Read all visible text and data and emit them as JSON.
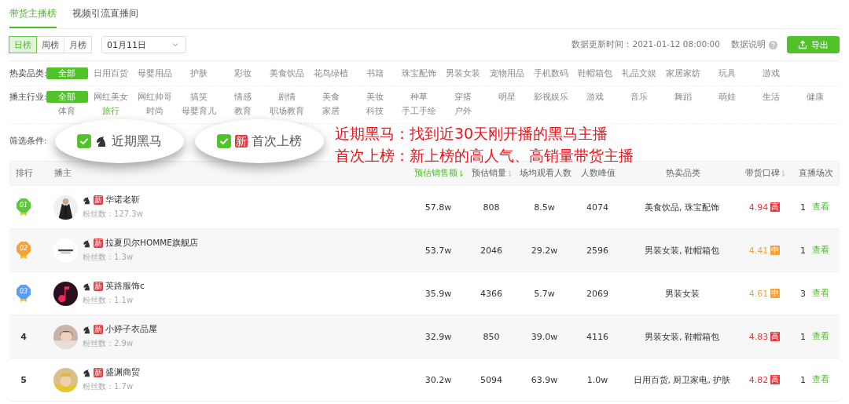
{
  "tabs": [
    {
      "label": "带货主播榜",
      "selected": true
    },
    {
      "label": "视频引流直播间",
      "selected": false
    }
  ],
  "periods": [
    {
      "label": "日榜",
      "selected": true
    },
    {
      "label": "周榜",
      "selected": false
    },
    {
      "label": "月榜",
      "selected": false
    }
  ],
  "date_select": {
    "value": "01月11日"
  },
  "update_time": "数据更新时间：2021-01-12 08:00:00",
  "data_help": "数据说明",
  "export_button": "导出",
  "hot_categories": {
    "label": "热卖品类:",
    "items": [
      {
        "label": "全部",
        "selected": true
      },
      {
        "label": "日用百货",
        "selected": false
      },
      {
        "label": "母婴用品",
        "selected": false
      },
      {
        "label": "护肤",
        "selected": false
      },
      {
        "label": "彩妆",
        "selected": false
      },
      {
        "label": "美食饮品",
        "selected": false
      },
      {
        "label": "花鸟绿植",
        "selected": false
      },
      {
        "label": "书籍",
        "selected": false
      },
      {
        "label": "珠宝配饰",
        "selected": false
      },
      {
        "label": "男装女装",
        "selected": false
      },
      {
        "label": "宠物用品",
        "selected": false
      },
      {
        "label": "手机数码",
        "selected": false
      },
      {
        "label": "鞋帽箱包",
        "selected": false
      },
      {
        "label": "礼品文娱",
        "selected": false
      },
      {
        "label": "家居家纺",
        "selected": false
      },
      {
        "label": "玩具",
        "selected": false
      },
      {
        "label": "游戏",
        "selected": false
      }
    ]
  },
  "industries": {
    "label": "播主行业:",
    "items": [
      {
        "label": "全部",
        "selected": true,
        "highlighted": false
      },
      {
        "label": "网红美女",
        "selected": false,
        "highlighted": false
      },
      {
        "label": "网红帅哥",
        "selected": false,
        "highlighted": false
      },
      {
        "label": "搞笑",
        "selected": false,
        "highlighted": false
      },
      {
        "label": "情感",
        "selected": false,
        "highlighted": false
      },
      {
        "label": "剧情",
        "selected": false,
        "highlighted": false
      },
      {
        "label": "美食",
        "selected": false,
        "highlighted": false
      },
      {
        "label": "美妆",
        "selected": false,
        "highlighted": false
      },
      {
        "label": "种草",
        "selected": false,
        "highlighted": false
      },
      {
        "label": "穿搭",
        "selected": false,
        "highlighted": false
      },
      {
        "label": "明星",
        "selected": false,
        "highlighted": false
      },
      {
        "label": "影视娱乐",
        "selected": false,
        "highlighted": false
      },
      {
        "label": "游戏",
        "selected": false,
        "highlighted": false
      },
      {
        "label": "音乐",
        "selected": false,
        "highlighted": false
      },
      {
        "label": "舞蹈",
        "selected": false,
        "highlighted": false
      },
      {
        "label": "萌娃",
        "selected": false,
        "highlighted": false
      },
      {
        "label": "生活",
        "selected": false,
        "highlighted": false
      },
      {
        "label": "健康",
        "selected": false,
        "highlighted": false
      },
      {
        "label": "体育",
        "selected": false,
        "highlighted": false
      },
      {
        "label": "旅行",
        "selected": false,
        "highlighted": true
      },
      {
        "label": "时尚",
        "selected": false,
        "highlighted": false
      },
      {
        "label": "母婴育儿",
        "selected": false,
        "highlighted": false
      },
      {
        "label": "教育",
        "selected": false,
        "highlighted": false
      },
      {
        "label": "职场教育",
        "selected": false,
        "highlighted": false
      },
      {
        "label": "家居",
        "selected": false,
        "highlighted": false
      },
      {
        "label": "科技",
        "selected": false,
        "highlighted": false
      },
      {
        "label": "手工手绘",
        "selected": false,
        "highlighted": false
      },
      {
        "label": "户外",
        "selected": false,
        "highlighted": false
      }
    ]
  },
  "filters": {
    "label": "筛选条件:",
    "options": [
      {
        "kind": "horse",
        "label": "近期黑马",
        "checked": true
      },
      {
        "kind": "badge",
        "badge": "新",
        "label": "首次上榜",
        "checked": true
      }
    ]
  },
  "annotation": [
    "近期黑马：找到近30天刚开播的黑马主播",
    "首次上榜：新上榜的高人气、高销量带货主播"
  ],
  "table": {
    "columns": [
      {
        "label": "排行"
      },
      {
        "label": "播主"
      },
      {
        "label": "预估销售额",
        "sorted": true
      },
      {
        "label": "预估销量",
        "sorted": false
      },
      {
        "label": "场均观看人数"
      },
      {
        "label": "人数峰值"
      },
      {
        "label": "热卖品类"
      },
      {
        "label": "带货口碑",
        "sorted": false
      },
      {
        "label": "直播场次"
      }
    ],
    "rows": [
      {
        "rank": "01",
        "medal": true,
        "color": "#5cc93b",
        "tag": "新",
        "name": "华诺老靳",
        "fans": "粉丝数：127.3w",
        "sales": "57.8w",
        "volume": "808",
        "avg_viewers": "8.5w",
        "peak": "4074",
        "categories": "美食饮品, 珠宝配饰",
        "rating": {
          "value": "4.94",
          "badge": "高",
          "color": "#e8373f"
        },
        "sessions": "1",
        "link": "查看"
      },
      {
        "rank": "02",
        "medal": true,
        "color": "#f5a23c",
        "tag": "新",
        "name": "拉夏贝尔HOMME旗舰店",
        "fans": "粉丝数：1.3w",
        "sales": "53.7w",
        "volume": "2046",
        "avg_viewers": "29.2w",
        "peak": "2596",
        "categories": "男装女装, 鞋帽箱包",
        "rating": {
          "value": "4.41",
          "badge": "中",
          "color": "#f5a23c"
        },
        "sessions": "1",
        "link": "查看"
      },
      {
        "rank": "03",
        "medal": true,
        "color": "#5b9ef0",
        "tag": "新",
        "name": "英路服饰c",
        "fans": "粉丝数：1.1w",
        "sales": "35.9w",
        "volume": "4366",
        "avg_viewers": "5.7w",
        "peak": "2069",
        "categories": "男装女装",
        "rating": {
          "value": "4.61",
          "badge": "中",
          "color": "#f5a23c"
        },
        "sessions": "3",
        "link": "查看"
      },
      {
        "rank": "4",
        "medal": false,
        "tag": "新",
        "name": "小婷子衣品屋",
        "fans": "粉丝数：2.9w",
        "sales": "32.9w",
        "volume": "850",
        "avg_viewers": "39.0w",
        "peak": "4116",
        "categories": "男装女装, 鞋帽箱包",
        "rating": {
          "value": "4.83",
          "badge": "高",
          "color": "#e8373f"
        },
        "sessions": "1",
        "link": "查看"
      },
      {
        "rank": "5",
        "medal": false,
        "tag": "新",
        "name": "盛渊商贸",
        "fans": "粉丝数：1.7w",
        "sales": "30.2w",
        "volume": "5094",
        "avg_viewers": "63.9w",
        "peak": "1.0w",
        "categories": "日用百货, 厨卫家电, 护肤",
        "rating": {
          "value": "4.82",
          "badge": "高",
          "color": "#e8373f"
        },
        "sessions": "1",
        "link": "查看"
      }
    ]
  }
}
